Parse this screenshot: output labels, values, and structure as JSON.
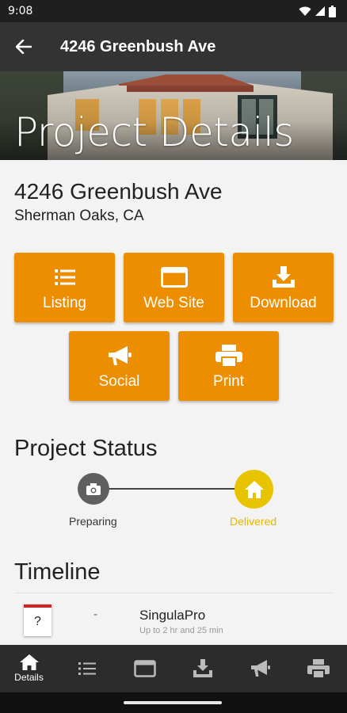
{
  "status_bar": {
    "time": "9:08",
    "icons": [
      "wifi-icon",
      "signal-icon",
      "battery-icon"
    ]
  },
  "app_bar": {
    "back_icon": "arrow-back-icon",
    "title": "4246 Greenbush Ave"
  },
  "hero": {
    "title": "Project Details"
  },
  "address": {
    "line1": "4246 Greenbush Ave",
    "line2": "Sherman Oaks, CA"
  },
  "actions": [
    {
      "label": "Listing",
      "icon": "list-icon"
    },
    {
      "label": "Web Site",
      "icon": "browser-window-icon"
    },
    {
      "label": "Download",
      "icon": "download-icon"
    },
    {
      "label": "Social",
      "icon": "megaphone-icon"
    },
    {
      "label": "Print",
      "icon": "printer-icon"
    }
  ],
  "project_status": {
    "title": "Project Status",
    "steps": [
      {
        "label": "Preparing",
        "icon": "camera-icon",
        "color": "#5f5f5f"
      },
      {
        "label": "Delivered",
        "icon": "home-icon",
        "color": "#e8c400"
      }
    ]
  },
  "timeline": {
    "title": "Timeline",
    "items": [
      {
        "date_icon": "calendar-icon",
        "date_text": "?",
        "dash": "-",
        "name": "SingulaPro",
        "subtitle": "Up to 2 hr and 25 min"
      }
    ]
  },
  "bottom_nav": [
    {
      "label": "Details",
      "icon": "home-icon",
      "active": true
    },
    {
      "label": "",
      "icon": "list-icon"
    },
    {
      "label": "",
      "icon": "browser-window-icon"
    },
    {
      "label": "",
      "icon": "download-icon"
    },
    {
      "label": "",
      "icon": "megaphone-icon"
    },
    {
      "label": "",
      "icon": "printer-icon"
    }
  ],
  "colors": {
    "accent": "#ec8e00",
    "app_bar": "#333333",
    "delivered": "#e8c400",
    "preparing": "#5f5f5f"
  }
}
